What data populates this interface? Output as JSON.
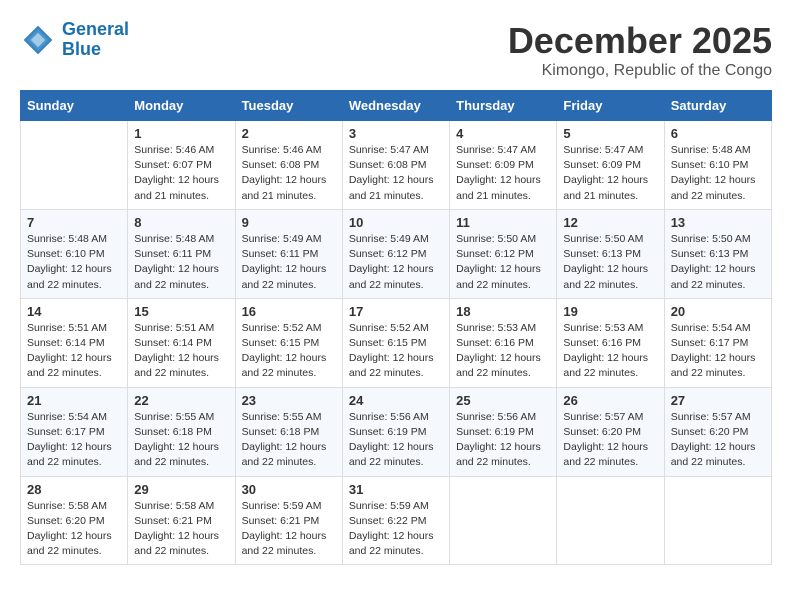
{
  "header": {
    "logo_line1": "General",
    "logo_line2": "Blue",
    "month": "December 2025",
    "location": "Kimongo, Republic of the Congo"
  },
  "weekdays": [
    "Sunday",
    "Monday",
    "Tuesday",
    "Wednesday",
    "Thursday",
    "Friday",
    "Saturday"
  ],
  "weeks": [
    [
      {
        "day": "",
        "info": ""
      },
      {
        "day": "1",
        "info": "Sunrise: 5:46 AM\nSunset: 6:07 PM\nDaylight: 12 hours\nand 21 minutes."
      },
      {
        "day": "2",
        "info": "Sunrise: 5:46 AM\nSunset: 6:08 PM\nDaylight: 12 hours\nand 21 minutes."
      },
      {
        "day": "3",
        "info": "Sunrise: 5:47 AM\nSunset: 6:08 PM\nDaylight: 12 hours\nand 21 minutes."
      },
      {
        "day": "4",
        "info": "Sunrise: 5:47 AM\nSunset: 6:09 PM\nDaylight: 12 hours\nand 21 minutes."
      },
      {
        "day": "5",
        "info": "Sunrise: 5:47 AM\nSunset: 6:09 PM\nDaylight: 12 hours\nand 21 minutes."
      },
      {
        "day": "6",
        "info": "Sunrise: 5:48 AM\nSunset: 6:10 PM\nDaylight: 12 hours\nand 22 minutes."
      }
    ],
    [
      {
        "day": "7",
        "info": "Sunrise: 5:48 AM\nSunset: 6:10 PM\nDaylight: 12 hours\nand 22 minutes."
      },
      {
        "day": "8",
        "info": "Sunrise: 5:48 AM\nSunset: 6:11 PM\nDaylight: 12 hours\nand 22 minutes."
      },
      {
        "day": "9",
        "info": "Sunrise: 5:49 AM\nSunset: 6:11 PM\nDaylight: 12 hours\nand 22 minutes."
      },
      {
        "day": "10",
        "info": "Sunrise: 5:49 AM\nSunset: 6:12 PM\nDaylight: 12 hours\nand 22 minutes."
      },
      {
        "day": "11",
        "info": "Sunrise: 5:50 AM\nSunset: 6:12 PM\nDaylight: 12 hours\nand 22 minutes."
      },
      {
        "day": "12",
        "info": "Sunrise: 5:50 AM\nSunset: 6:13 PM\nDaylight: 12 hours\nand 22 minutes."
      },
      {
        "day": "13",
        "info": "Sunrise: 5:50 AM\nSunset: 6:13 PM\nDaylight: 12 hours\nand 22 minutes."
      }
    ],
    [
      {
        "day": "14",
        "info": "Sunrise: 5:51 AM\nSunset: 6:14 PM\nDaylight: 12 hours\nand 22 minutes."
      },
      {
        "day": "15",
        "info": "Sunrise: 5:51 AM\nSunset: 6:14 PM\nDaylight: 12 hours\nand 22 minutes."
      },
      {
        "day": "16",
        "info": "Sunrise: 5:52 AM\nSunset: 6:15 PM\nDaylight: 12 hours\nand 22 minutes."
      },
      {
        "day": "17",
        "info": "Sunrise: 5:52 AM\nSunset: 6:15 PM\nDaylight: 12 hours\nand 22 minutes."
      },
      {
        "day": "18",
        "info": "Sunrise: 5:53 AM\nSunset: 6:16 PM\nDaylight: 12 hours\nand 22 minutes."
      },
      {
        "day": "19",
        "info": "Sunrise: 5:53 AM\nSunset: 6:16 PM\nDaylight: 12 hours\nand 22 minutes."
      },
      {
        "day": "20",
        "info": "Sunrise: 5:54 AM\nSunset: 6:17 PM\nDaylight: 12 hours\nand 22 minutes."
      }
    ],
    [
      {
        "day": "21",
        "info": "Sunrise: 5:54 AM\nSunset: 6:17 PM\nDaylight: 12 hours\nand 22 minutes."
      },
      {
        "day": "22",
        "info": "Sunrise: 5:55 AM\nSunset: 6:18 PM\nDaylight: 12 hours\nand 22 minutes."
      },
      {
        "day": "23",
        "info": "Sunrise: 5:55 AM\nSunset: 6:18 PM\nDaylight: 12 hours\nand 22 minutes."
      },
      {
        "day": "24",
        "info": "Sunrise: 5:56 AM\nSunset: 6:19 PM\nDaylight: 12 hours\nand 22 minutes."
      },
      {
        "day": "25",
        "info": "Sunrise: 5:56 AM\nSunset: 6:19 PM\nDaylight: 12 hours\nand 22 minutes."
      },
      {
        "day": "26",
        "info": "Sunrise: 5:57 AM\nSunset: 6:20 PM\nDaylight: 12 hours\nand 22 minutes."
      },
      {
        "day": "27",
        "info": "Sunrise: 5:57 AM\nSunset: 6:20 PM\nDaylight: 12 hours\nand 22 minutes."
      }
    ],
    [
      {
        "day": "28",
        "info": "Sunrise: 5:58 AM\nSunset: 6:20 PM\nDaylight: 12 hours\nand 22 minutes."
      },
      {
        "day": "29",
        "info": "Sunrise: 5:58 AM\nSunset: 6:21 PM\nDaylight: 12 hours\nand 22 minutes."
      },
      {
        "day": "30",
        "info": "Sunrise: 5:59 AM\nSunset: 6:21 PM\nDaylight: 12 hours\nand 22 minutes."
      },
      {
        "day": "31",
        "info": "Sunrise: 5:59 AM\nSunset: 6:22 PM\nDaylight: 12 hours\nand 22 minutes."
      },
      {
        "day": "",
        "info": ""
      },
      {
        "day": "",
        "info": ""
      },
      {
        "day": "",
        "info": ""
      }
    ]
  ]
}
